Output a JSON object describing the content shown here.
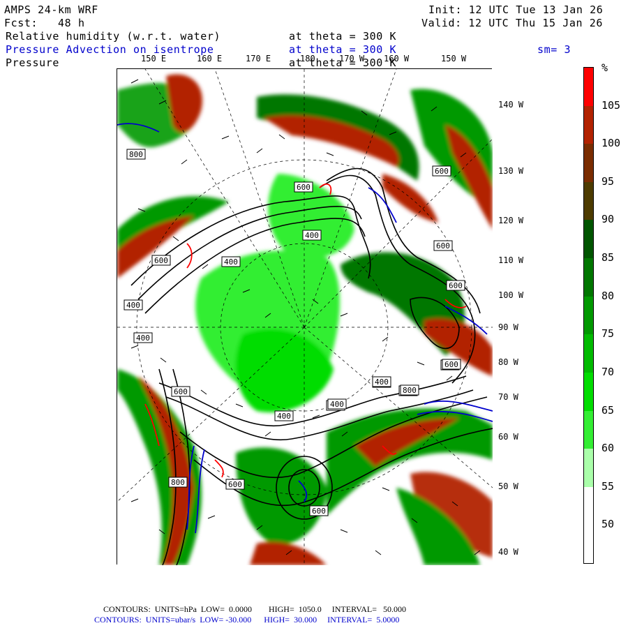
{
  "header": {
    "model": "AMPS 24-km WRF",
    "forecast": "Fcst:   48 h",
    "init": "Init: 12 UTC Tue 13 Jan 26",
    "valid": "Valid: 12 UTC Thu 15 Jan 26"
  },
  "fields": [
    {
      "name": "Relative humidity (w.r.t. water)",
      "level": "at theta = 300 K",
      "color": "#000000"
    },
    {
      "name": "Pressure Advection on isentrope",
      "level": "at theta = 300 K",
      "color": "#0000cc",
      "smoothing": "sm= 3"
    },
    {
      "name": "Pressure",
      "level": "at theta = 300 K",
      "color": "#000000"
    }
  ],
  "longitude_labels_top": [
    "150 E",
    "160 E",
    "170 E",
    "180",
    "170 W",
    "160 W",
    "150 W"
  ],
  "longitude_labels_right": [
    "140 W",
    "130 W",
    "120 W",
    "110 W",
    "100 W",
    "90 W",
    "80 W",
    "70 W",
    "60 W",
    "50 W",
    "40 W"
  ],
  "contour_labels": [
    "800",
    "600",
    "400",
    "600",
    "400",
    "600",
    "600",
    "400",
    "400",
    "600",
    "400",
    "800",
    "600",
    "600",
    "400",
    "800",
    "400",
    "400",
    "400",
    "600",
    "600",
    "600",
    "800"
  ],
  "colorbar": {
    "unit": "%",
    "levels": [
      105,
      100,
      95,
      90,
      85,
      80,
      75,
      70,
      65,
      60,
      55,
      50
    ],
    "colors": [
      "#ff0000",
      "#b22200",
      "#7a2c00",
      "#4d3b00",
      "#005500",
      "#007700",
      "#009900",
      "#00bb00",
      "#00dd00",
      "#33ee33",
      "#aaffaa",
      "#ffffff",
      "#ffffff"
    ]
  },
  "footer": {
    "line1": "CONTOURS:  UNITS=hPa  LOW=  0.0000        HIGH=  1050.0     INTERVAL=   50.000",
    "line2": "CONTOURS:  UNITS=ubar/s  LOW= -30.000      HIGH=  30.000     INTERVAL=  5.0000"
  }
}
